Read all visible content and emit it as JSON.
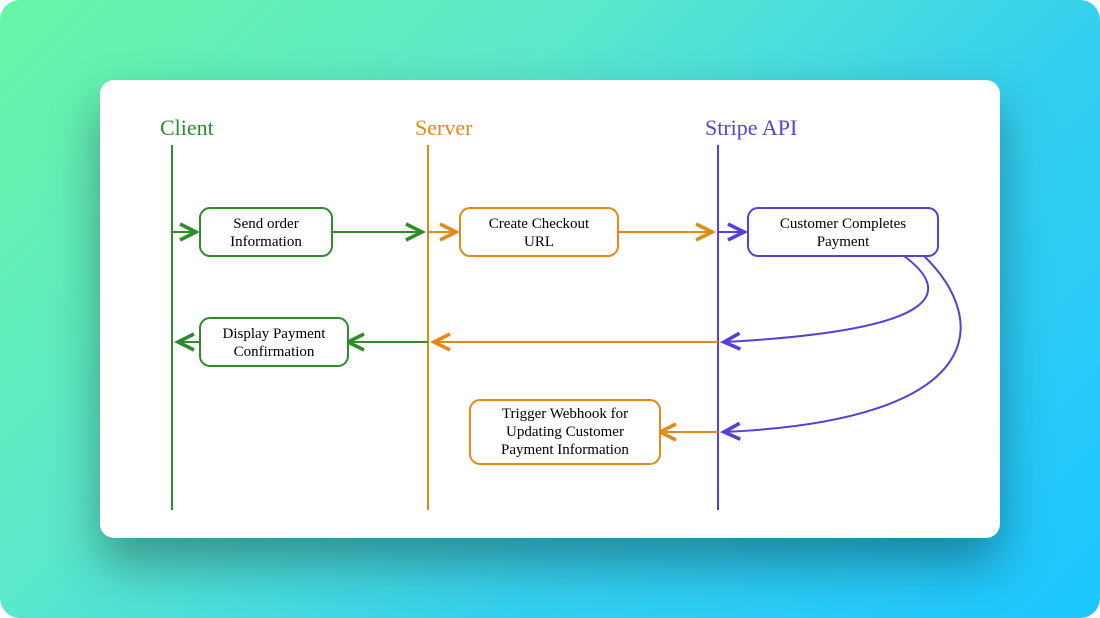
{
  "colors": {
    "green": "#2e8b2e",
    "orange": "#e08a1a",
    "purple": "#5a3fd4"
  },
  "lanes": {
    "client": "Client",
    "server": "Server",
    "stripe": "Stripe API"
  },
  "nodes": {
    "send_order": {
      "l1": "Send order",
      "l2": "Information"
    },
    "create_checkout": {
      "l1": "Create Checkout",
      "l2": "URL"
    },
    "customer_completes": {
      "l1": "Customer Completes",
      "l2": "Payment"
    },
    "display_confirmation": {
      "l1": "Display Payment",
      "l2": "Confirmation"
    },
    "trigger_webhook": {
      "l1": "Trigger Webhook for",
      "l2": "Updating Customer",
      "l3": "Payment Information"
    }
  }
}
